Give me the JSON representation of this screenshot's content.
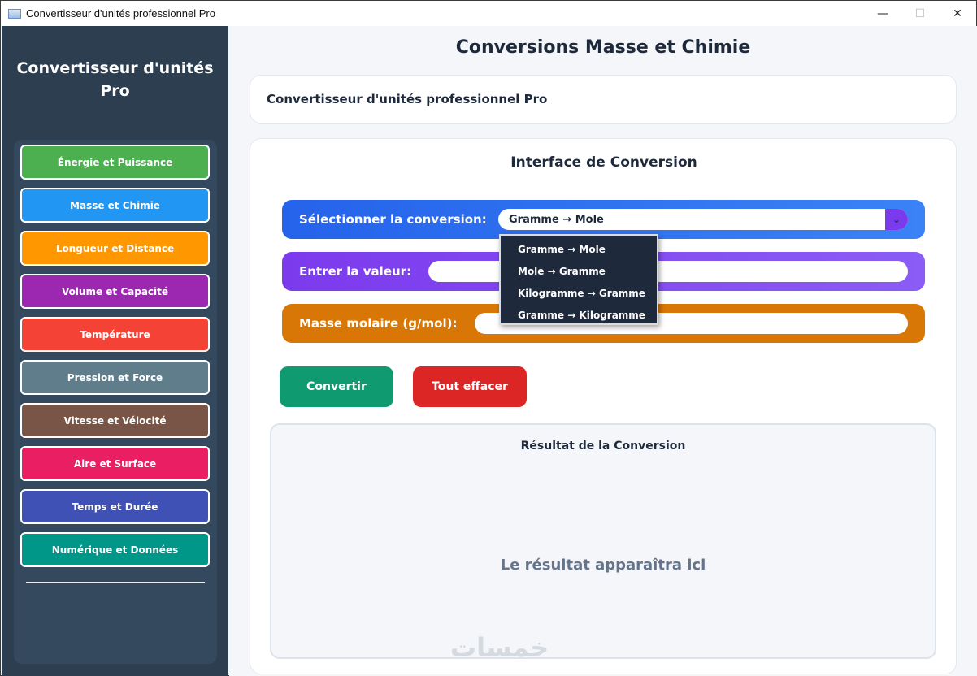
{
  "window": {
    "title": "Convertisseur d'unités professionnel Pro",
    "controls": {
      "minimize": "—",
      "maximize": "☐",
      "close": "✕"
    }
  },
  "sidebar": {
    "title_line1": "Convertisseur d'unités",
    "title_line2": "Pro",
    "items": [
      {
        "label": "Énergie et Puissance",
        "color": "#4caf50"
      },
      {
        "label": "Masse et Chimie",
        "color": "#2196f3"
      },
      {
        "label": "Longueur et Distance",
        "color": "#ff9800"
      },
      {
        "label": "Volume et Capacité",
        "color": "#9c27b0"
      },
      {
        "label": "Température",
        "color": "#f44336"
      },
      {
        "label": "Pression et Force",
        "color": "#607d8b"
      },
      {
        "label": "Vitesse et Vélocité",
        "color": "#795548"
      },
      {
        "label": "Aire et Surface",
        "color": "#e91e63"
      },
      {
        "label": "Temps et Durée",
        "color": "#3f51b5"
      },
      {
        "label": "Numérique et Données",
        "color": "#009688"
      }
    ]
  },
  "main": {
    "page_title": "Conversions Masse et Chimie",
    "header_text": "Convertisseur d'unités professionnel Pro",
    "interface_title": "Interface de Conversion",
    "select_label": "Sélectionner la conversion:",
    "select_value": "Gramme → Mole",
    "value_label": "Entrer la valeur:",
    "value_input": "",
    "molar_label": "Masse molaire (g/mol):",
    "molar_input": "",
    "convert_button": "Convertir",
    "clear_button": "Tout effacer",
    "result_title": "Résultat de la Conversion",
    "result_placeholder": "Le résultat apparaîtra ici",
    "watermark": "خمسات"
  },
  "dropdown": {
    "options": [
      "Gramme → Mole",
      "Mole → Gramme",
      "Kilogramme → Gramme",
      "Gramme → Kilogramme"
    ]
  }
}
